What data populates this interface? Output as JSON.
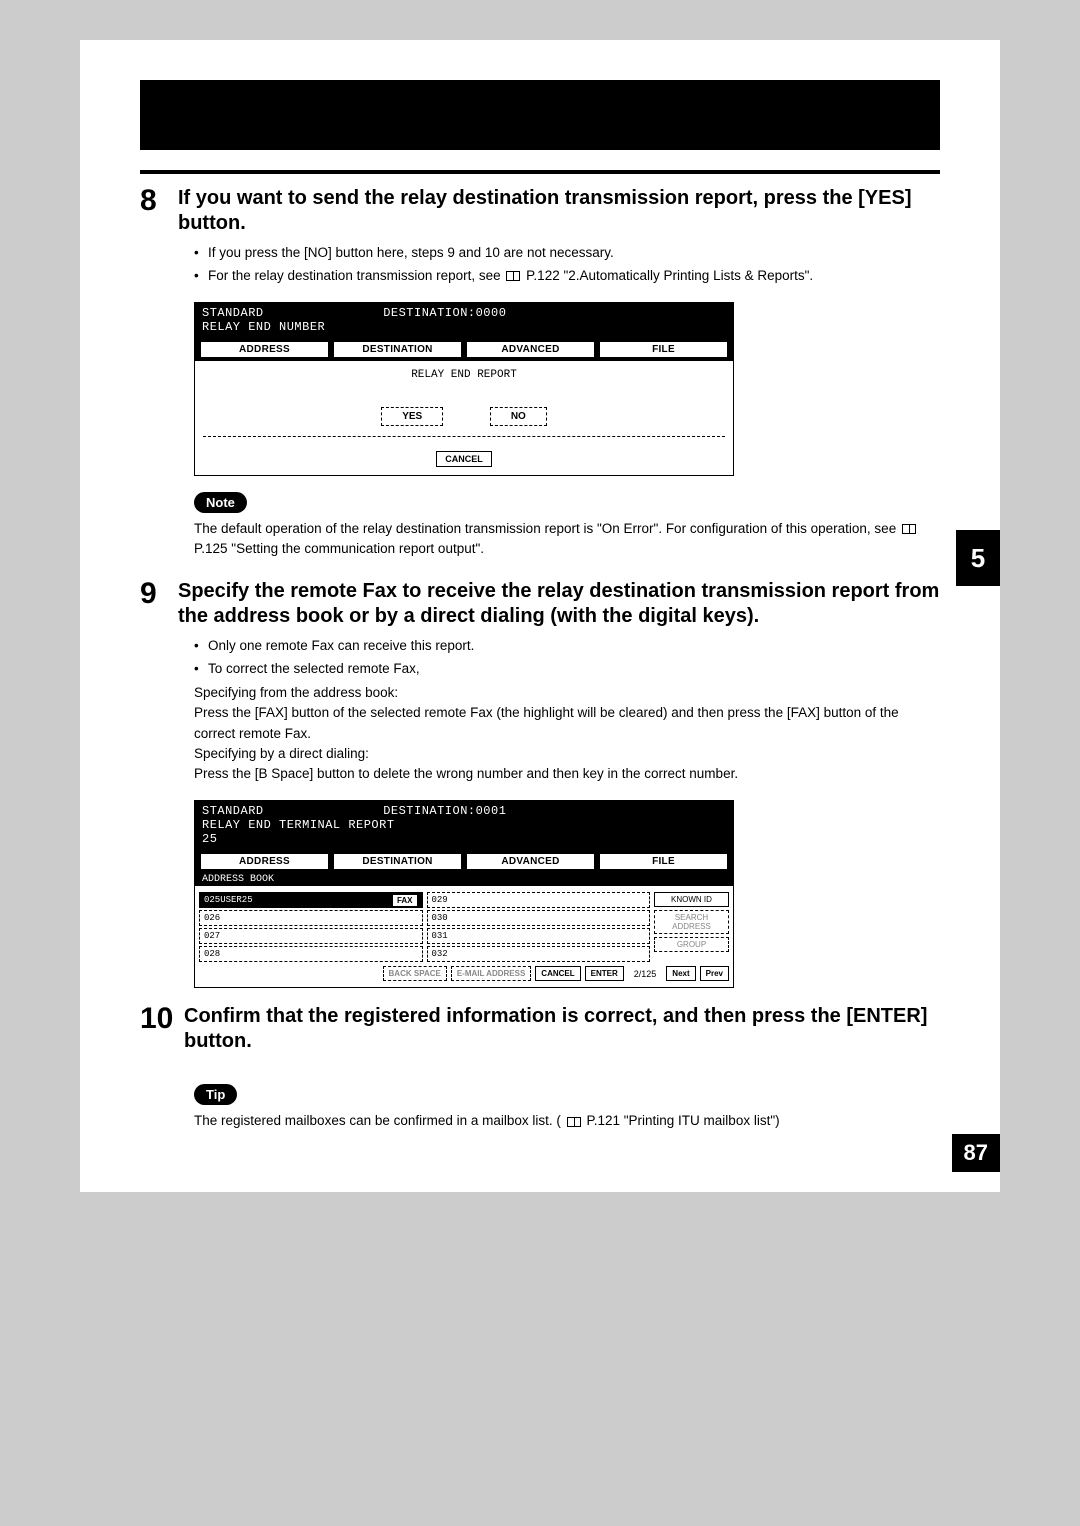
{
  "step8": {
    "num": "8",
    "title": "If you want to send the relay destination transmission report, press the [YES] button.",
    "bullets": [
      "If you press the [NO] button here, steps 9 and 10 are not necessary.",
      "For the relay destination transmission report, see"
    ],
    "ref1": "P.122 \"2.Automatically Printing Lists & Reports\"."
  },
  "screenshot1": {
    "header_left": "STANDARD",
    "header_right": "DESTINATION:0000",
    "header_line2": "RELAY END NUMBER",
    "tabs": [
      "ADDRESS",
      "DESTINATION",
      "ADVANCED",
      "FILE"
    ],
    "body_title": "RELAY END REPORT",
    "yes": "YES",
    "no": "NO",
    "cancel": "CANCEL"
  },
  "note": {
    "label": "Note",
    "text1": "The default operation of the relay destination transmission report is \"On Error\". For configuration of this operation, see",
    "ref": "P.125 \"Setting the communication report output\"."
  },
  "section_tab": "5",
  "step9": {
    "num": "9",
    "title": "Specify the remote Fax to receive the relay destination transmission report from the address book or by a direct dialing (with the digital keys).",
    "bullet1": "Only one remote Fax can receive this report.",
    "bullet2": "To correct the selected remote Fax,",
    "line1": "Specifying from the address book:",
    "line2": "Press the [FAX] button of the selected remote Fax (the highlight will be cleared) and then press the [FAX] button of the correct remote Fax.",
    "line3": "Specifying by a direct dialing:",
    "line4": "Press the [B Space] button to delete the wrong number and then key in the correct number."
  },
  "screenshot2": {
    "header_left": "STANDARD",
    "header_right": "DESTINATION:0001",
    "header_line2": "RELAY END TERMINAL REPORT",
    "header_line3": "25",
    "tabs": [
      "ADDRESS",
      "DESTINATION",
      "ADVANCED",
      "FILE"
    ],
    "sub": "ADDRESS BOOK",
    "col1": [
      {
        "num": "025",
        "label": "USER25",
        "selected": true,
        "fax": "FAX"
      },
      {
        "num": "026"
      },
      {
        "num": "027"
      },
      {
        "num": "028"
      }
    ],
    "col2": [
      {
        "num": "029"
      },
      {
        "num": "030"
      },
      {
        "num": "031"
      },
      {
        "num": "032"
      }
    ],
    "side": [
      "KNOWN ID",
      "SEARCH ADDRESS",
      "GROUP"
    ],
    "footer": {
      "backspace": "BACK SPACE",
      "email": "E-MAIL ADDRESS",
      "cancel": "CANCEL",
      "enter": "ENTER",
      "pager": "2/125",
      "next": "Next",
      "prev": "Prev"
    }
  },
  "step10": {
    "num": "10",
    "title": "Confirm that the registered information is correct, and then press the [ENTER] button."
  },
  "tip": {
    "label": "Tip",
    "text1": "The registered mailboxes can be confirmed in a mailbox list. (",
    "ref": "P.121 \"Printing ITU mailbox list\")"
  },
  "page_number": "87"
}
